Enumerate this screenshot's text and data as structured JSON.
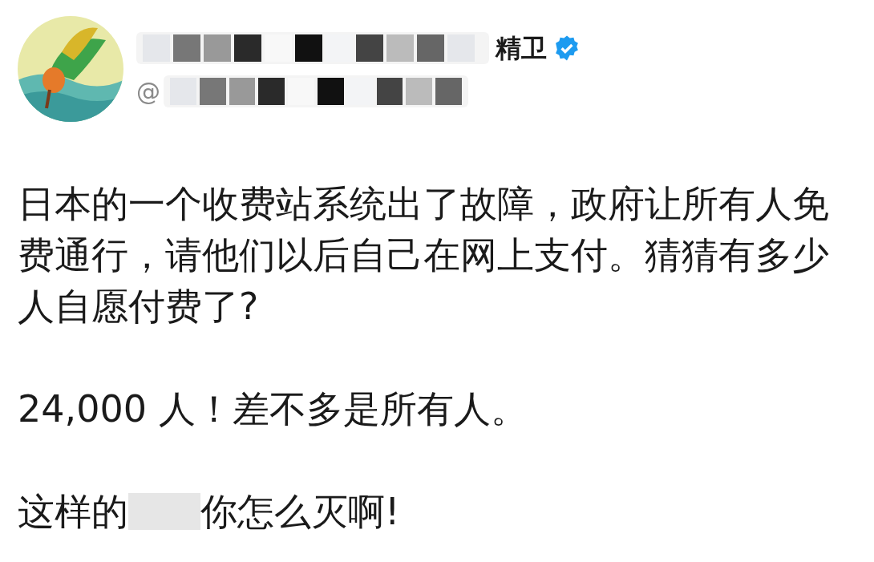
{
  "author": {
    "name": "精卫",
    "handle": "@",
    "verified": true
  },
  "paragraphs": [
    {
      "text": "日本的一个收费站系统出了故障，政府让所有人免费通行，请他们以后自己在网上支付。猜猜有多少人自愿付费了?"
    },
    {
      "text": "24,000 人！差不多是所有人。"
    }
  ],
  "last_line": {
    "before": "这样的",
    "after": "你怎么灭啊!"
  }
}
